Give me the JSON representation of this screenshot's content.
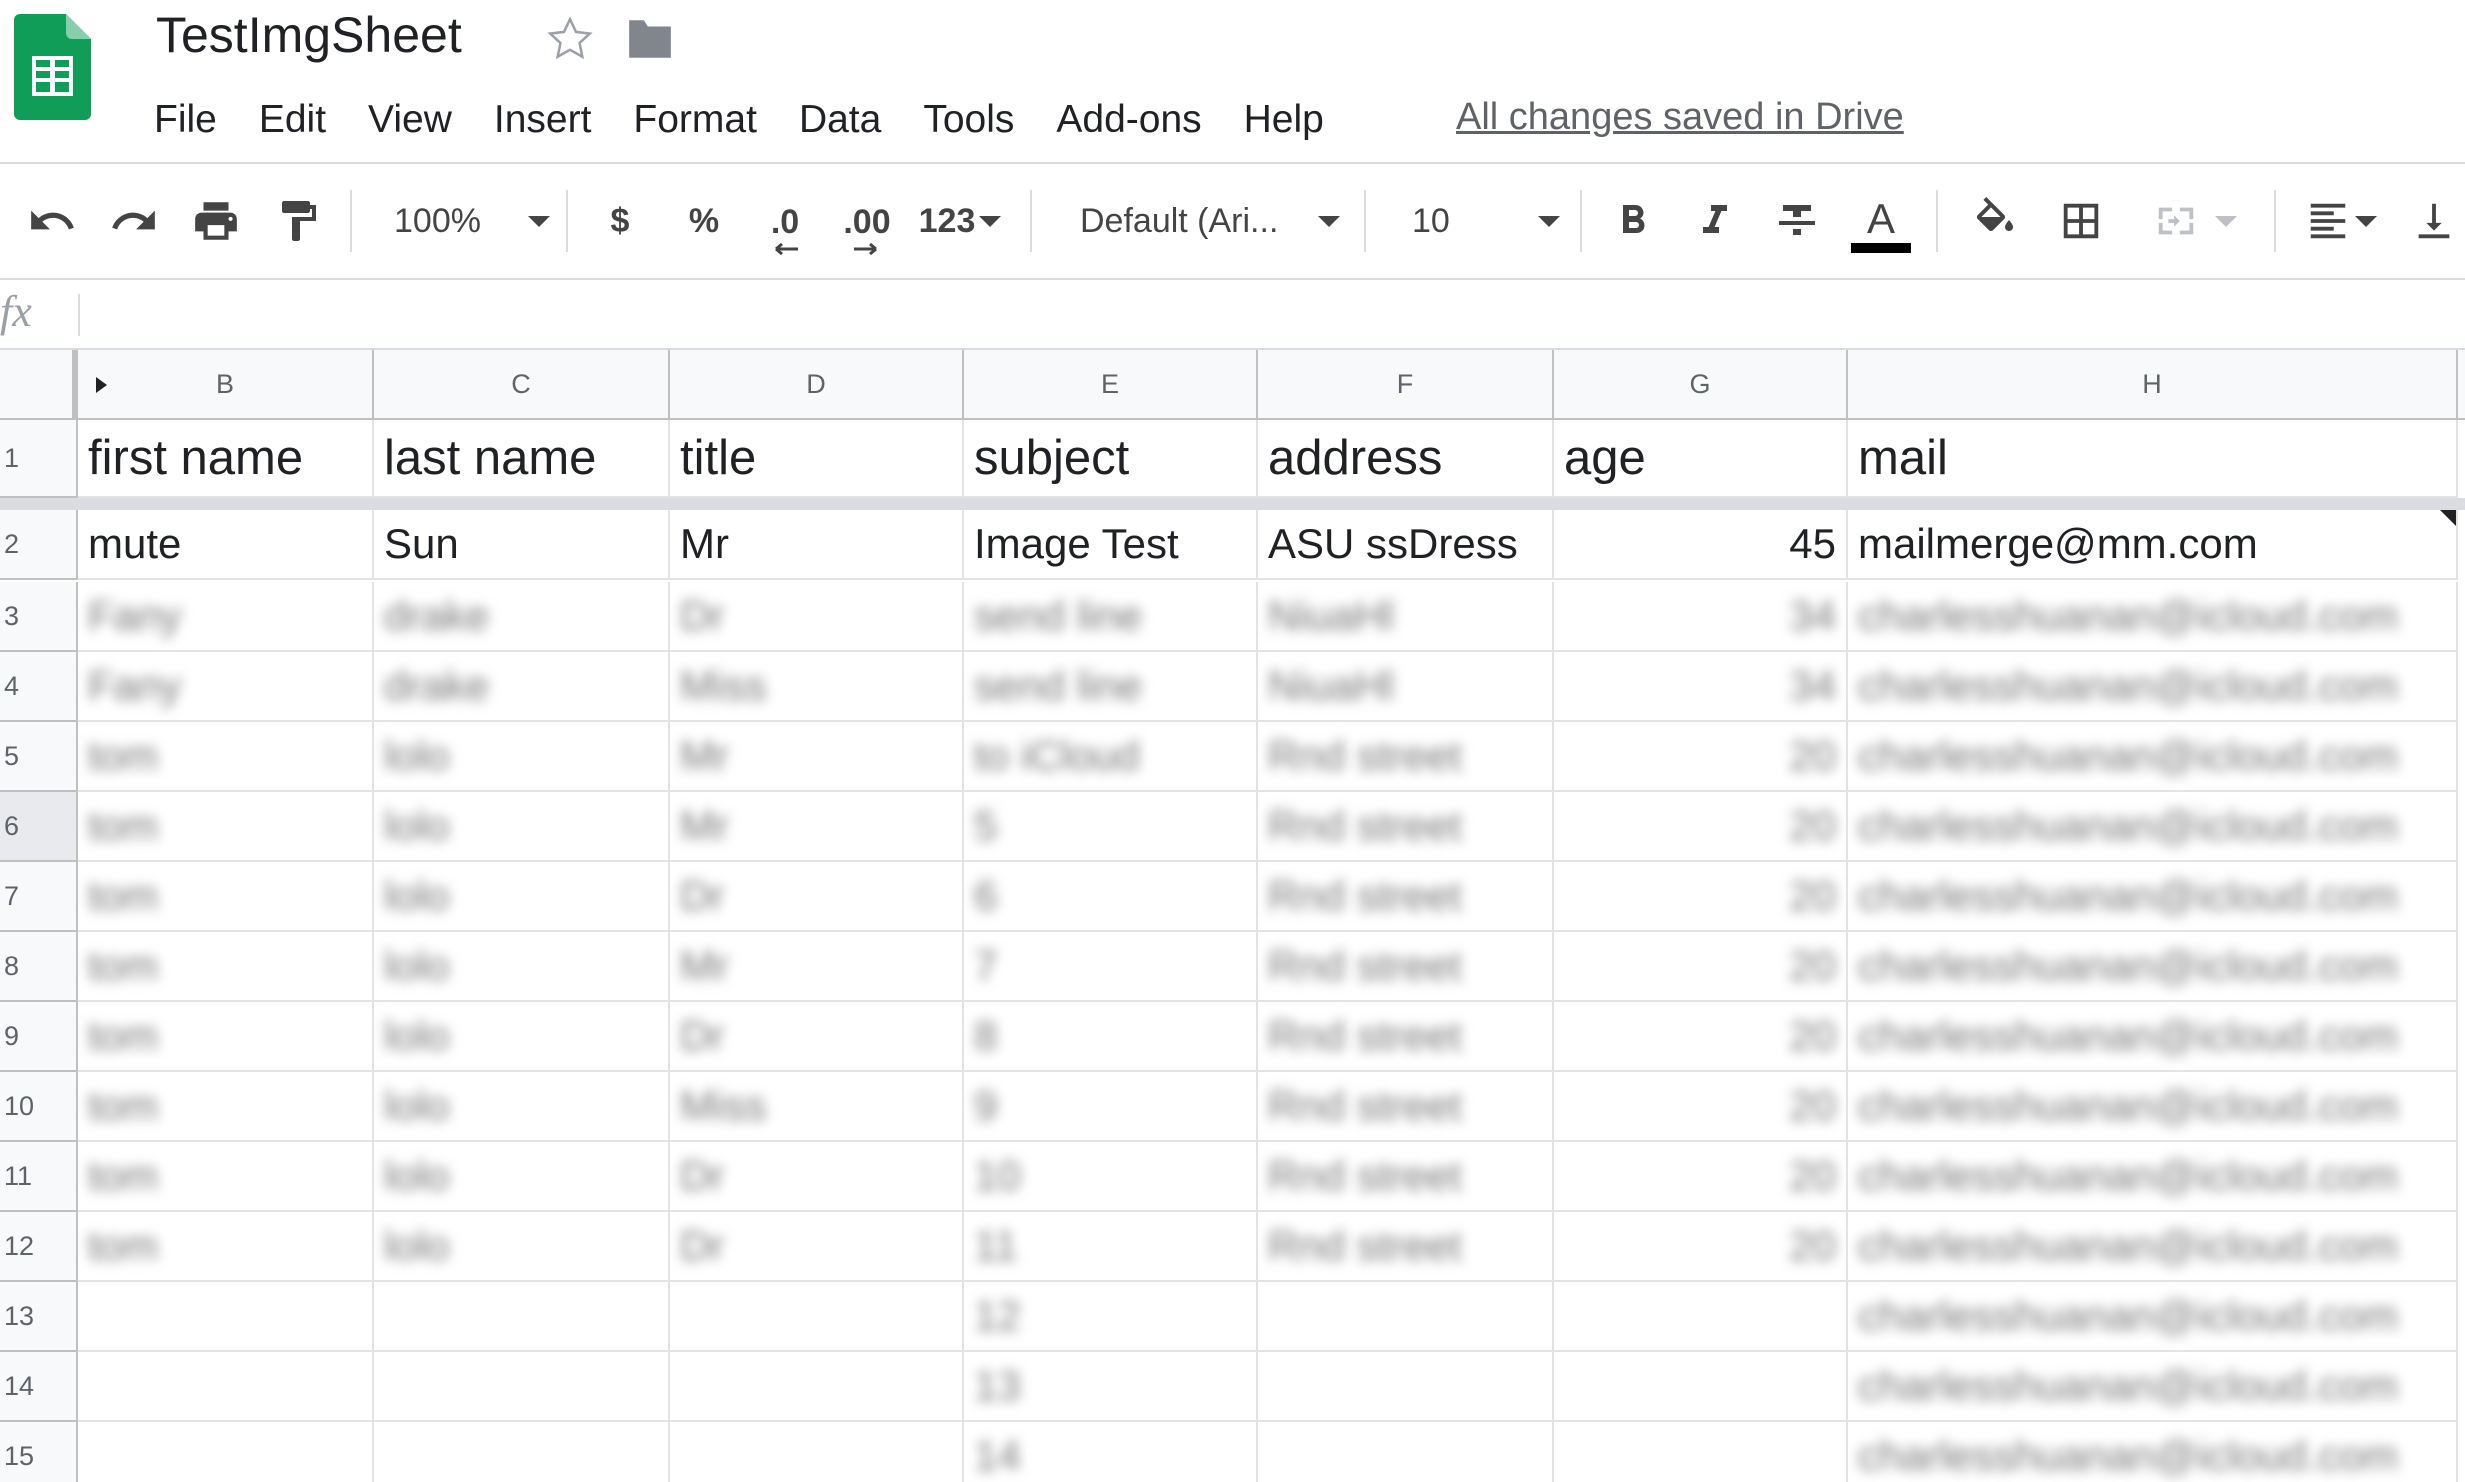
{
  "title": "TestImgSheet",
  "menu": [
    "File",
    "Edit",
    "View",
    "Insert",
    "Format",
    "Data",
    "Tools",
    "Add-ons",
    "Help"
  ],
  "save_status": "All changes saved in Drive",
  "toolbar": {
    "zoom": "100%",
    "currency": "$",
    "percent": "%",
    "decrease_decimals": ".0",
    "increase_decimals": ".00",
    "more_formats": "123",
    "font": "Default (Ari...",
    "font_size": "10",
    "text_color": "#000000"
  },
  "formula_bar": {
    "fx": "fx",
    "value": ""
  },
  "columns": [
    "B",
    "C",
    "D",
    "E",
    "F",
    "G",
    "H"
  ],
  "header_row": {
    "number": "1",
    "cells": [
      "first name",
      "last name",
      "title",
      "subject",
      "address",
      "age",
      "mail"
    ]
  },
  "data_row": {
    "number": "2",
    "cells": [
      "mute",
      "Sun",
      "Mr",
      "Image Test",
      "ASU ssDress",
      "45",
      "mailmerge@mm.com"
    ]
  },
  "blurred_rows": [
    {
      "n": "3",
      "v": [
        "Fany",
        "drake",
        "Dr",
        "send line",
        "NiuaHl",
        "34",
        "charlesshuanan@icloud.com"
      ]
    },
    {
      "n": "4",
      "v": [
        "Fany",
        "drake",
        "Miss",
        "send line",
        "NiuaHl",
        "34",
        "charlesshuanan@icloud.com"
      ]
    },
    {
      "n": "5",
      "v": [
        "tom",
        "lolo",
        "Mr",
        "to iCloud",
        "Rnd street",
        "20",
        "charlesshuanan@icloud.com"
      ]
    },
    {
      "n": "6",
      "v": [
        "tom",
        "lolo",
        "Mr",
        "5",
        "Rnd street",
        "20",
        "charlesshuanan@icloud.com"
      ]
    },
    {
      "n": "7",
      "v": [
        "tom",
        "lolo",
        "Dr",
        "6",
        "Rnd street",
        "20",
        "charlesshuanan@icloud.com"
      ]
    },
    {
      "n": "8",
      "v": [
        "tom",
        "lolo",
        "Mr",
        "7",
        "Rnd street",
        "20",
        "charlesshuanan@icloud.com"
      ]
    },
    {
      "n": "9",
      "v": [
        "tom",
        "lolo",
        "Dr",
        "8",
        "Rnd street",
        "20",
        "charlesshuanan@icloud.com"
      ]
    },
    {
      "n": "10",
      "v": [
        "tom",
        "lolo",
        "Miss",
        "9",
        "Rnd street",
        "20",
        "charlesshuanan@icloud.com"
      ]
    },
    {
      "n": "11",
      "v": [
        "tom",
        "lolo",
        "Dr",
        "10",
        "Rnd street",
        "20",
        "charlesshuanan@icloud.com"
      ]
    },
    {
      "n": "12",
      "v": [
        "tom",
        "lolo",
        "Dr",
        "11",
        "Rnd street",
        "20",
        "charlesshuanan@icloud.com"
      ]
    },
    {
      "n": "13",
      "v": [
        "",
        "",
        "",
        "12",
        "",
        "",
        "charlesshuanan@icloud.com"
      ]
    },
    {
      "n": "14",
      "v": [
        "",
        "",
        "",
        "13",
        "",
        "",
        "charlesshuanan@icloud.com"
      ]
    },
    {
      "n": "15",
      "v": [
        "",
        "",
        "",
        "14",
        "",
        "",
        "charlesshuanan@icloud.com"
      ]
    }
  ],
  "colors": {
    "sheets_green": "#0f9d58",
    "sheets_green_dark": "#0b8043",
    "header_bg": "#f8f9fa",
    "grid_line": "#e2e3e3"
  }
}
